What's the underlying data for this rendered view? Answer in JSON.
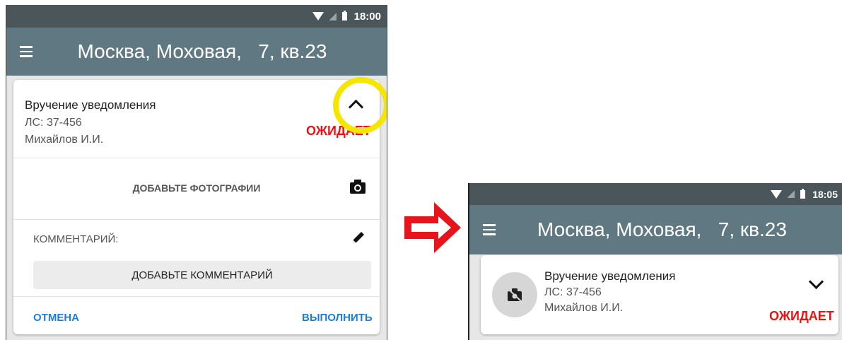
{
  "left_screen": {
    "status_bar": {
      "time": "18:00"
    },
    "app_bar": {
      "title": "Москва, Моховая,   7, кв.23"
    },
    "task": {
      "title": "Вручение уведомления",
      "account": "ЛС: 37-456",
      "person": "Михайлов И.И.",
      "status": "ОЖИДАЕТ"
    },
    "photos_label": "ДОБАВЬТЕ ФОТОГРАФИИ",
    "comment_label": "КОММЕНТАРИЙ:",
    "add_comment_label": "ДОБАВЬТЕ КОММЕНТАРИЙ",
    "cancel_label": "ОТМЕНА",
    "complete_label": "ВЫПОЛНИТЬ"
  },
  "right_screen": {
    "status_bar": {
      "time": "18:05"
    },
    "app_bar": {
      "title": "Москва, Моховая,   7, кв.23"
    },
    "task": {
      "title": "Вручение уведомления",
      "account": "ЛС: 37-456",
      "person": "Михайлов И.И.",
      "status": "ОЖИДАЕТ"
    }
  },
  "colors": {
    "status_bar": "#4b565b",
    "app_bar": "#5f7882",
    "status_pending": "#ee1111",
    "action_link": "#1a7fdb",
    "highlight_ring": "#f5e600",
    "transition_arrow": "#e8141c"
  },
  "icons": [
    "menu-icon",
    "wifi-icon",
    "signal-icon",
    "battery-icon",
    "chevron-up-icon",
    "chevron-down-icon",
    "camera-icon",
    "pencil-icon",
    "no-photo-icon",
    "arrow-right-icon"
  ]
}
